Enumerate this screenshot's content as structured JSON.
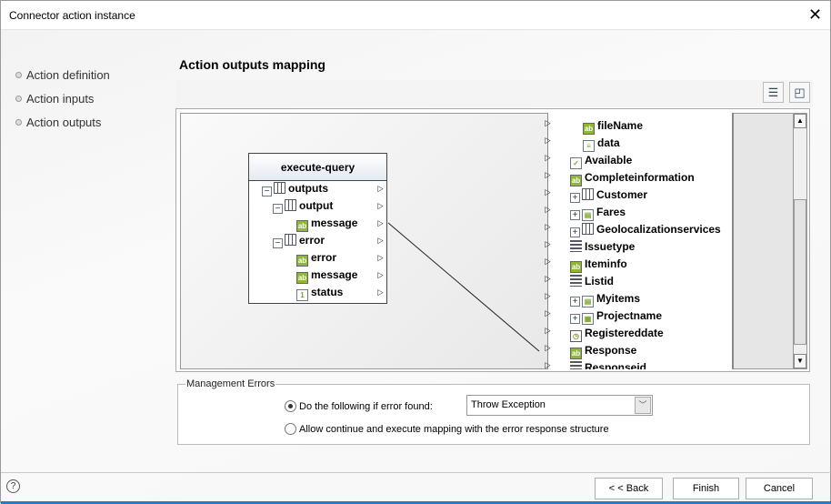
{
  "window": {
    "title": "Connector action instance",
    "close_icon": "close-icon"
  },
  "nav": {
    "items": [
      {
        "label": "Action definition"
      },
      {
        "label": "Action inputs"
      },
      {
        "label": "Action outputs"
      }
    ]
  },
  "main": {
    "heading": "Action outputs mapping",
    "toolbar": {
      "auto_map_icon": "auto-map-icon",
      "layout_icon": "fit-layout-icon"
    }
  },
  "source": {
    "title": "execute-query",
    "items": [
      {
        "label": "outputs",
        "icon": "table",
        "expander": "-",
        "level": 0
      },
      {
        "label": "output",
        "icon": "table",
        "expander": "-",
        "level": 1
      },
      {
        "label": "message",
        "icon": "text",
        "level": 2
      },
      {
        "label": "error",
        "icon": "table",
        "expander": "-",
        "level": 1
      },
      {
        "label": "error",
        "icon": "text",
        "level": 2
      },
      {
        "label": "message",
        "icon": "text",
        "level": 2
      },
      {
        "label": "status",
        "icon": "number",
        "level": 2
      }
    ]
  },
  "target": {
    "items": [
      {
        "label": "fileName",
        "icon": "text",
        "level": 1
      },
      {
        "label": "data",
        "icon": "doc",
        "level": 1
      },
      {
        "label": "Available",
        "icon": "check",
        "level": 0
      },
      {
        "label": "Completeinformation",
        "icon": "text",
        "level": 0
      },
      {
        "label": "Customer",
        "icon": "table",
        "expander": "+",
        "level": 0
      },
      {
        "label": "Fares",
        "icon": "form",
        "expander": "+",
        "level": 0
      },
      {
        "label": "Geolocalizationservices",
        "icon": "table",
        "expander": "+",
        "level": 0
      },
      {
        "label": "Issuetype",
        "icon": "list",
        "level": 0
      },
      {
        "label": "Iteminfo",
        "icon": "text",
        "level": 0
      },
      {
        "label": "Listid",
        "icon": "list",
        "level": 0
      },
      {
        "label": "Myitems",
        "icon": "form",
        "expander": "+",
        "level": 0
      },
      {
        "label": "Projectname",
        "icon": "grid",
        "expander": "+",
        "level": 0
      },
      {
        "label": "Registereddate",
        "icon": "date",
        "level": 0
      },
      {
        "label": "Response",
        "icon": "text",
        "level": 0
      },
      {
        "label": "Responseid",
        "icon": "list",
        "level": 0
      }
    ]
  },
  "mapping": {
    "source": "message",
    "target": "Response"
  },
  "errors": {
    "legend": "Management Errors",
    "option1": "Do the following if error found:",
    "option2": "Allow continue and execute mapping with the error response structure",
    "selected_option": 1,
    "action_value": "Throw Exception"
  },
  "footer": {
    "back": "< < Back",
    "finish": "Finish",
    "cancel": "Cancel",
    "help": "?"
  }
}
